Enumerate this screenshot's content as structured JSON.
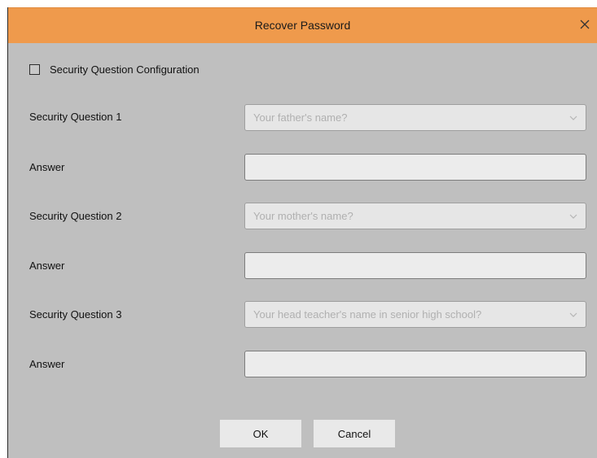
{
  "dialog": {
    "title": "Recover Password",
    "close_icon": "close-icon"
  },
  "config": {
    "checkbox_label": "Security Question Configuration",
    "checked": false
  },
  "questions": [
    {
      "label": "Security Question 1",
      "selected": "Your father's name?",
      "answer_label": "Answer",
      "answer_value": ""
    },
    {
      "label": "Security Question 2",
      "selected": "Your mother's name?",
      "answer_label": "Answer",
      "answer_value": ""
    },
    {
      "label": "Security Question 3",
      "selected": "Your head teacher's name in senior high school?",
      "answer_label": "Answer",
      "answer_value": ""
    }
  ],
  "buttons": {
    "ok": "OK",
    "cancel": "Cancel"
  },
  "colors": {
    "titlebar": "#ef9a4c",
    "panel": "#bfbfbf",
    "field": "#ececec",
    "button": "#e9e9e9"
  }
}
